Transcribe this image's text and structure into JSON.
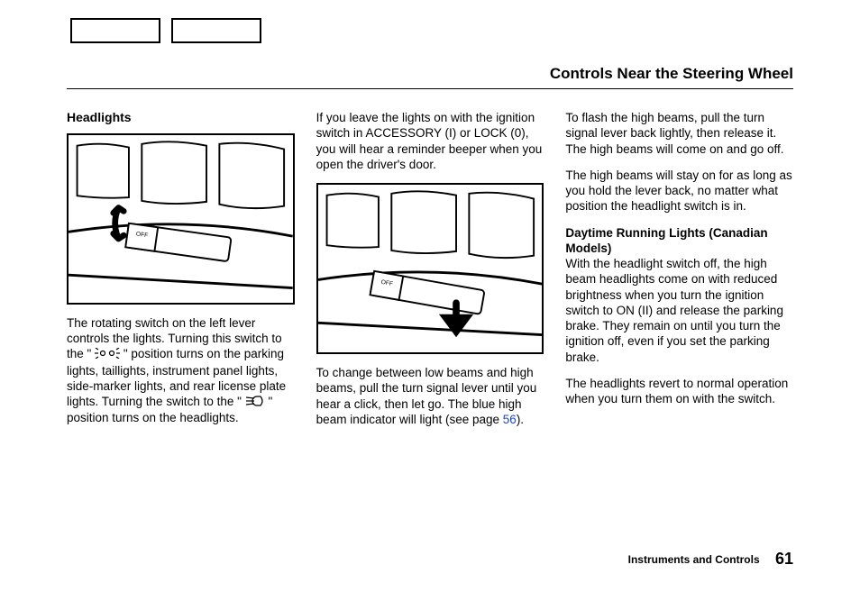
{
  "page_title": "Controls Near the Steering Wheel",
  "footer": {
    "section": "Instruments and Controls",
    "page_number": "61"
  },
  "col1": {
    "heading": "Headlights",
    "p1_a": "The rotating switch on the left lever controls the lights. Turning this switch to the \"",
    "p1_b": "\" position turns on the parking lights, taillights, instrument panel lights, side-marker lights, and rear license plate lights. Turning the switch to the \"",
    "p1_c": "\" position turns on the headlights."
  },
  "col2": {
    "p1": "If you leave the lights on with the ignition switch in ACCESSORY (I) or LOCK (0), you will hear a reminder beeper when you open the driver's door.",
    "p2_a": "To change between low beams and high beams, pull the turn signal lever until you hear a click, then let go. The blue high beam indicator will light (see page ",
    "p2_link": "56",
    "p2_b": ")."
  },
  "col3": {
    "p1": "To flash the high beams, pull the turn signal lever back lightly, then release it. The high beams will come on and go off.",
    "p2": "The high beams will stay on for as long as you hold the lever back, no matter what position the headlight switch is in.",
    "subheading": "Daytime Running Lights (Canadian Models)",
    "p3": "With the headlight switch off, the high beam headlights come on with reduced brightness when you turn the ignition switch to ON (II) and release the parking brake. They remain on until you turn the ignition off, even if you set the parking brake.",
    "p4": "The headlights revert to normal operation when you turn them on with the switch."
  },
  "icons": {
    "parking_lights": "parking-lights-icon",
    "headlights": "headlights-icon"
  }
}
